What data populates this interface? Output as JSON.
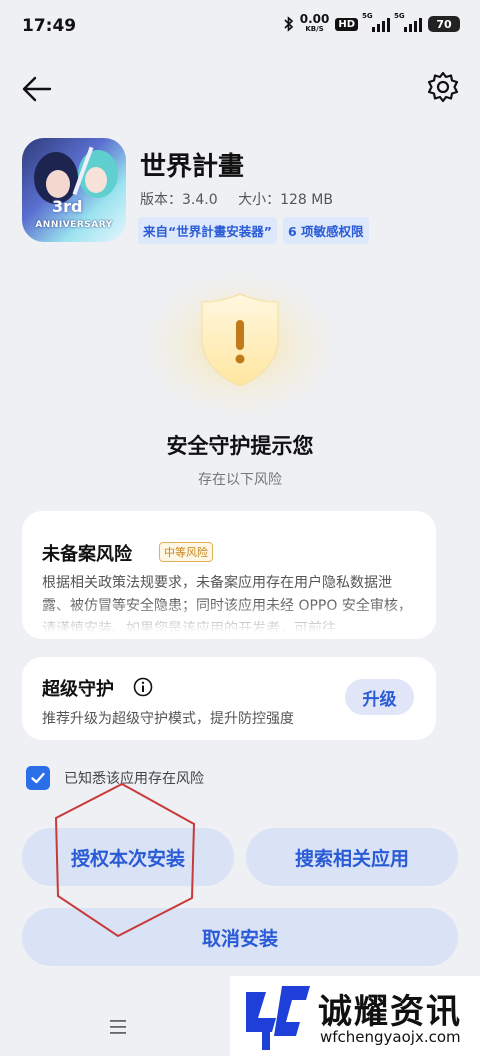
{
  "status_bar": {
    "time": "17:49",
    "net_speed_value": "0.00",
    "net_speed_unit": "KB/S",
    "hd_label": "HD",
    "sim1_label": "5G",
    "sim2_label": "5G",
    "battery": "70"
  },
  "header": {
    "back_icon": "arrow-left-icon",
    "settings_icon": "gear-icon"
  },
  "app": {
    "name": "世界計畫",
    "version_label": "版本：3.4.0",
    "size_label": "大小：128 MB",
    "source_tag": "来自“世界計畫安装器”",
    "permission_tag": "6 项敏感权限",
    "icon_text_3rd": "3rd",
    "icon_text_anniversary": "ANNIVERSARY"
  },
  "warning": {
    "icon": "shield-exclamation-icon",
    "title": "安全守护提示您",
    "subtitle": "存在以下风险"
  },
  "risk_card": {
    "title": "未备案风险",
    "badge": "中等风险",
    "description": "根据相关政策法规要求，未备案应用存在用户隐私数据泄露、被仿冒等安全隐患；同时该应用未经 OPPO 安全审核，请谨慎安装。如果您是该应用的开发者，可前往"
  },
  "guard_card": {
    "title": "超级守护",
    "description": "推荐升级为超级守护模式，提升防控强度",
    "upgrade_label": "升级"
  },
  "acknowledge": {
    "checked": true,
    "label": "已知悉该应用存在风险"
  },
  "buttons": {
    "authorize_label": "授权本次安装",
    "search_label": "搜索相关应用",
    "cancel_label": "取消安装"
  },
  "watermark": {
    "name": "诚耀资讯",
    "url": "wfchengyaojx.com"
  },
  "colors": {
    "accent": "#2a5bd7",
    "background": "#eef0f4",
    "button_bg": "#dae3f5",
    "risk_orange": "#c7841a",
    "annotation_red": "#c8393b"
  }
}
